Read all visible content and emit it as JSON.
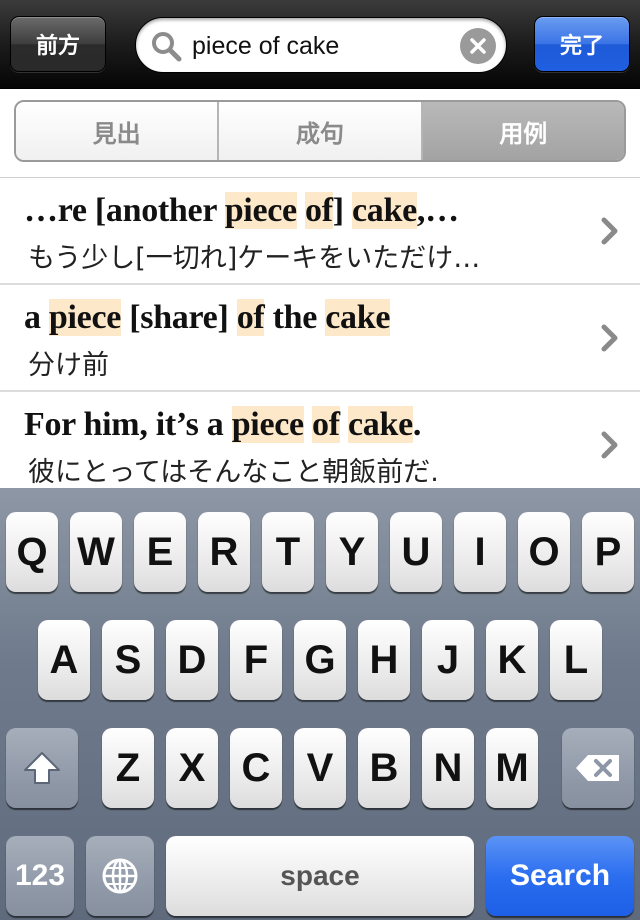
{
  "nav": {
    "back_label": "前方",
    "done_label": "完了"
  },
  "search": {
    "value": "piece of cake",
    "icons": {
      "search": "search-icon",
      "clear": "clear-icon"
    }
  },
  "segments": [
    {
      "label": "見出",
      "selected": false
    },
    {
      "label": "成句",
      "selected": false
    },
    {
      "label": "用例",
      "selected": true
    }
  ],
  "results": [
    {
      "title_parts": [
        {
          "text": "…re [another ",
          "hl": false
        },
        {
          "text": "piece",
          "hl": true
        },
        {
          "text": " ",
          "hl": false
        },
        {
          "text": "of",
          "hl": true
        },
        {
          "text": "] ",
          "hl": false
        },
        {
          "text": "cake",
          "hl": true
        },
        {
          "text": ",…",
          "hl": false
        }
      ],
      "subtitle": "もう少し[一切れ]ケーキをいただけ…"
    },
    {
      "title_parts": [
        {
          "text": "a ",
          "hl": false
        },
        {
          "text": "piece",
          "hl": true
        },
        {
          "text": " [share] ",
          "hl": false
        },
        {
          "text": "of",
          "hl": true
        },
        {
          "text": " the ",
          "hl": false
        },
        {
          "text": "cake",
          "hl": true
        }
      ],
      "subtitle": "分け前"
    },
    {
      "title_parts": [
        {
          "text": "For him, it’s a ",
          "hl": false
        },
        {
          "text": "piece",
          "hl": true
        },
        {
          "text": " ",
          "hl": false
        },
        {
          "text": "of",
          "hl": true
        },
        {
          "text": " ",
          "hl": false
        },
        {
          "text": "cake",
          "hl": true
        },
        {
          "text": ".",
          "hl": false
        }
      ],
      "subtitle": "彼にとってはそんなこと朝飯前だ."
    }
  ],
  "keyboard": {
    "row1": [
      "Q",
      "W",
      "E",
      "R",
      "T",
      "Y",
      "U",
      "I",
      "O",
      "P"
    ],
    "row2": [
      "A",
      "S",
      "D",
      "F",
      "G",
      "H",
      "J",
      "K",
      "L"
    ],
    "row3": [
      "Z",
      "X",
      "C",
      "V",
      "B",
      "N",
      "M"
    ],
    "numbers_label": "123",
    "space_label": "space",
    "search_label": "Search",
    "icons": {
      "shift": "shift-icon",
      "backspace": "backspace-icon",
      "globe": "globe-icon"
    }
  },
  "colors": {
    "highlight": "#fde8c9",
    "accent_blue": "#2c6ef0"
  }
}
